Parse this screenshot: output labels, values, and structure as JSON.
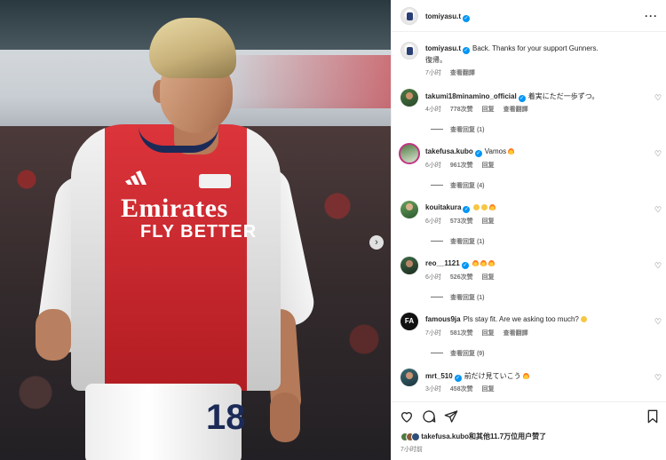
{
  "post": {
    "author": "tomiyasu.t",
    "caption": "Back. Thanks for your support Gunners.",
    "caption_line2": "復帰。",
    "caption_time": "7小时",
    "translate": "查看翻譯",
    "shirt_sponsor_line1": "Emirates",
    "shirt_sponsor_line2": "FLY BETTER",
    "shirt_number": "18"
  },
  "comments": [
    {
      "user": "takumi18minamino_official",
      "text": "着実にただ一歩ずつ。",
      "time": "4小时",
      "likes": "778次赞",
      "reply": "回复",
      "translate": "查看翻譯",
      "replies": "查看回复 (1)"
    },
    {
      "user": "takefusa.kubo",
      "text": "Vamos",
      "emoji": "fire",
      "time": "6小时",
      "likes": "961次赞",
      "reply": "回复",
      "replies": "查看回复 (4)"
    },
    {
      "user": "kouitakura",
      "text": "",
      "emoji": "love-love-fire",
      "time": "6小时",
      "likes": "573次赞",
      "reply": "回复",
      "replies": "查看回复 (1)"
    },
    {
      "user": "reo__1121",
      "text": "",
      "emoji": "fire-fire-fire",
      "time": "6小时",
      "likes": "526次赞",
      "reply": "回复",
      "replies": "查看回复 (1)"
    },
    {
      "user": "famous9ja",
      "text": "Pls stay fit. Are we asking too much?",
      "emoji": "sad",
      "time": "7小时",
      "likes": "581次赞",
      "reply": "回复",
      "translate": "查看翻譯",
      "replies": "查看回复 (9)"
    },
    {
      "user": "mrt_510",
      "text": "前だけ見ていこう",
      "emoji": "fire",
      "time": "3小时",
      "likes": "458次赞",
      "reply": "回复"
    }
  ],
  "footer": {
    "likes_user": "takefusa.kubo",
    "likes_rest": "和其他11.7万位用户赞了",
    "time": "7小时前"
  },
  "icons": {
    "verified": "verified-badge-icon",
    "heart": "heart-icon",
    "comment": "comment-icon",
    "share": "share-icon",
    "save": "bookmark-icon",
    "more": "more-icon",
    "next": "chevron-right-icon"
  },
  "colors": {
    "verified": "#0095f6",
    "secondary_text": "#737373",
    "arsenal_red": "#d9232a"
  }
}
